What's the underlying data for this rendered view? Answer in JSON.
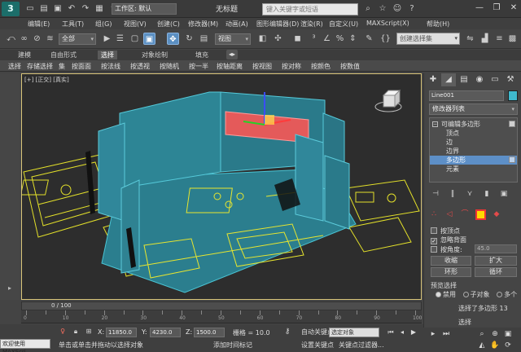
{
  "app": {
    "logo_text": "3",
    "workspace_label": "工作区: 默认",
    "doc_title": "无标题",
    "search_placeholder": "键入关键字或短语"
  },
  "menu": [
    "编辑(E)",
    "工具(T)",
    "组(G)",
    "视图(V)",
    "创建(C)",
    "修改器(M)",
    "动画(A)",
    "图形编辑器(D)",
    "渲染(R)",
    "自定义(U)",
    "MAXScript(X)",
    "帮助(H)"
  ],
  "toolbar": {
    "filter_select": "全部",
    "ref_coord": "视图",
    "selection_set_placeholder": "创建选择集"
  },
  "ribbon": {
    "tabs": [
      "建模",
      "自由形式",
      "选择",
      "对象绘制",
      "填充"
    ],
    "active_tab": "选择",
    "buttons": [
      "选择",
      "存储选择",
      "集",
      "按面面",
      "按法线",
      "按透视",
      "按随机",
      "按一半",
      "按轴距离",
      "按视图",
      "按对称",
      "按颜色",
      "按数值"
    ]
  },
  "viewport": {
    "label": "[+] [正交] [真实]"
  },
  "command_panel": {
    "object_name": "Line001",
    "object_color": "#3fb8cc",
    "modifier_list": "修改器列表",
    "stack": [
      {
        "label": "可编辑多边形",
        "marker": "−"
      },
      {
        "label": "顶点",
        "marker": ""
      },
      {
        "label": "边",
        "marker": ""
      },
      {
        "label": "边界",
        "marker": ""
      },
      {
        "label": "多边形",
        "marker": ""
      },
      {
        "label": "元素",
        "marker": ""
      }
    ],
    "selected_stack_item": "多边形",
    "by_vertex": "按顶点",
    "ignore_backfacing": "忽略背面",
    "by_angle": "按角度:",
    "angle_value": "45.0",
    "shrink": "收缩",
    "grow": "扩大",
    "ring": "环形",
    "loop": "循环",
    "preview_selection": "预览选择",
    "preview_options": [
      "禁用",
      "子对象",
      "多个"
    ],
    "selection_status": "选择了多边形 13",
    "select_button": "选择"
  },
  "timeline": {
    "frame": "0 / 100",
    "ruler_labels": [
      "0",
      "10",
      "20",
      "30",
      "40",
      "50",
      "60",
      "70",
      "80",
      "90",
      "100"
    ]
  },
  "status": {
    "maxscript": "欢迎使用 MAXScri",
    "x_label": "X:",
    "x_value": "11850.0",
    "y_label": "Y:",
    "y_value": "4230.0",
    "z_label": "Z:",
    "z_value": "1500.0",
    "grid": "栅格 = 10.0",
    "message": "单击或单击并拖动以选择对象",
    "add_time_tag": "添加时间标记",
    "auto_key": "自动关键点",
    "set_key": "设置关键点",
    "selected_object": "选定对象",
    "key_filter": "关键点过滤器..."
  }
}
